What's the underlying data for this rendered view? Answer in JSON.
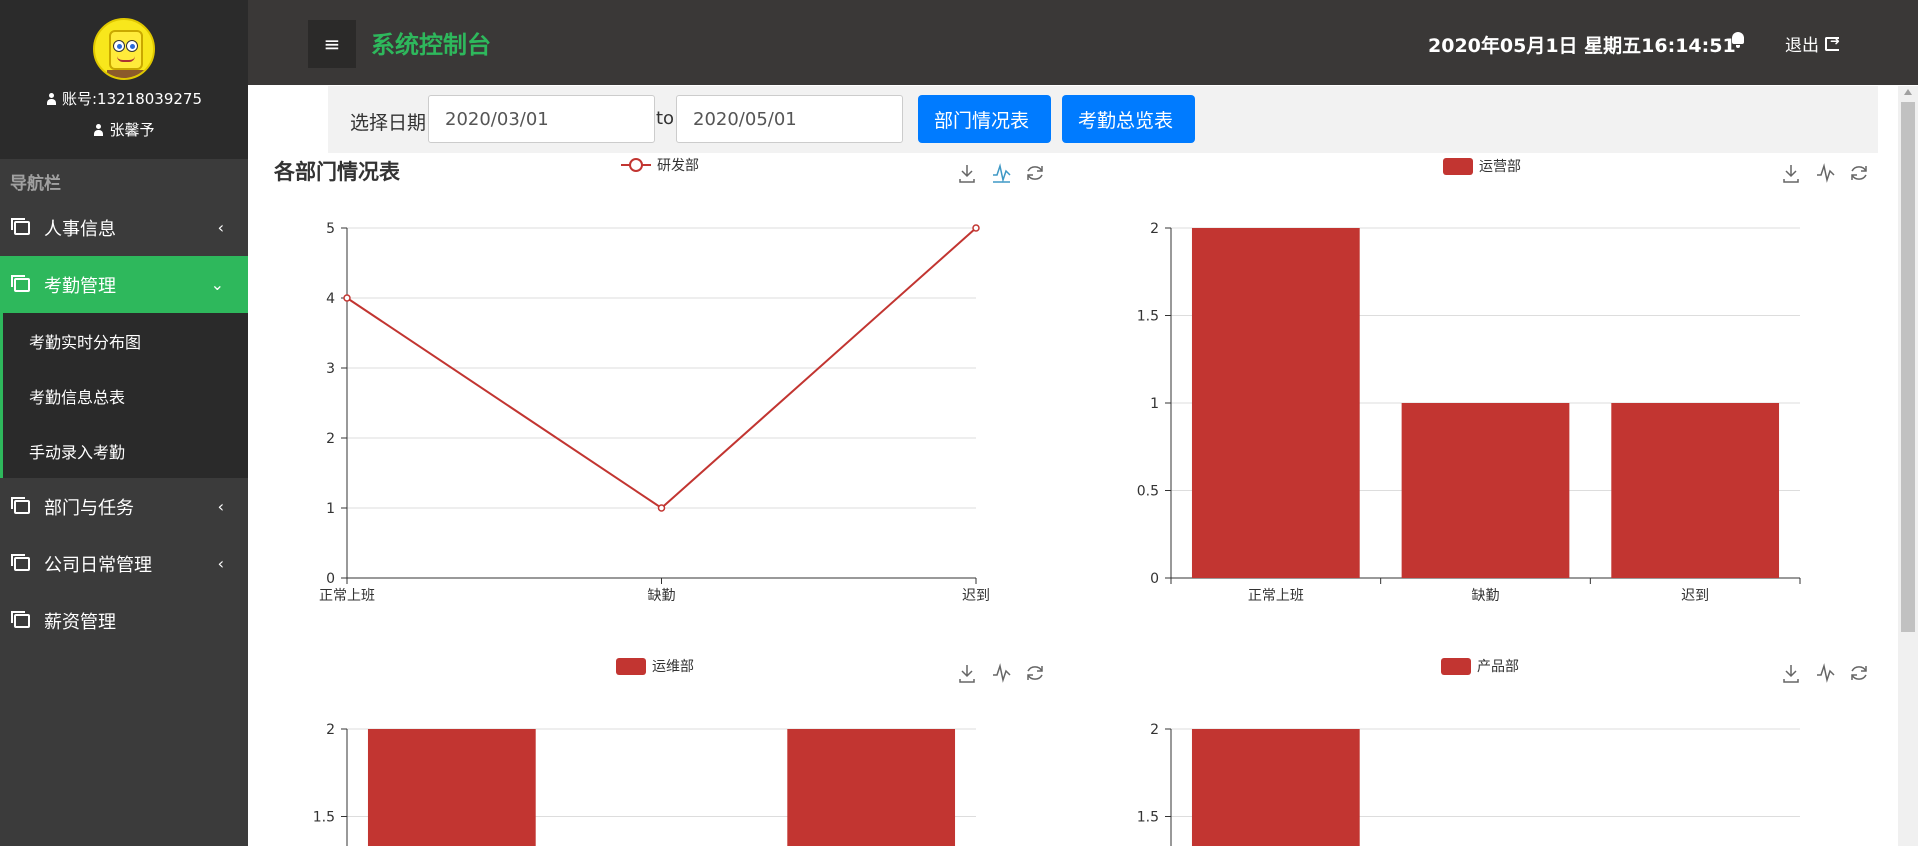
{
  "profile": {
    "account": "账号:13218039275",
    "name": "张馨予"
  },
  "nav": {
    "title": "导航栏",
    "items": [
      {
        "label": "人事信息",
        "chevron": "‹"
      },
      {
        "label": "考勤管理",
        "chevron": "⌄"
      },
      {
        "label": "部门与任务",
        "chevron": "‹"
      },
      {
        "label": "公司日常管理",
        "chevron": "‹"
      },
      {
        "label": "薪资管理",
        "chevron": ""
      }
    ],
    "subitems": [
      {
        "label": "考勤实时分布图"
      },
      {
        "label": "考勤信息总表"
      },
      {
        "label": "手动录入考勤"
      }
    ]
  },
  "header": {
    "brand": "系统控制台",
    "datetime": "2020年05月1日 星期五16:14:51",
    "logout": "退出"
  },
  "datebar": {
    "label": "选择日期",
    "from": "2020/03/01",
    "to_label": "to",
    "to": "2020/05/01",
    "btn_dept": "部门情况表",
    "btn_overview": "考勤总览表"
  },
  "panel": {
    "title": "各部门情况表"
  },
  "colors": {
    "series": "#c23531",
    "accent": "#2eb85c",
    "button": "#007bff"
  },
  "chart_data": [
    {
      "type": "line",
      "legend": "研发部",
      "categories": [
        "正常上班",
        "缺勤",
        "迟到"
      ],
      "series": [
        {
          "name": "研发部",
          "values": [
            4,
            1,
            5
          ]
        }
      ],
      "yticks": [
        "0",
        "1",
        "2",
        "3",
        "4",
        "5"
      ],
      "ylim": [
        0,
        5
      ]
    },
    {
      "type": "bar",
      "legend": "运营部",
      "categories": [
        "正常上班",
        "缺勤",
        "迟到"
      ],
      "series": [
        {
          "name": "运营部",
          "values": [
            2,
            1,
            1
          ]
        }
      ],
      "yticks": [
        "0",
        "0.5",
        "1",
        "1.5",
        "2"
      ],
      "ylim": [
        0,
        2
      ]
    },
    {
      "type": "bar",
      "legend": "运维部",
      "series": [
        {
          "name": "运维部",
          "values": [
            2,
            2
          ]
        }
      ],
      "yticks": [
        "1.5",
        "2"
      ],
      "ylim": [
        0,
        2
      ]
    },
    {
      "type": "bar",
      "legend": "产品部",
      "series": [
        {
          "name": "产品部",
          "values": [
            2
          ]
        }
      ],
      "yticks": [
        "1.5",
        "2"
      ],
      "ylim": [
        0,
        2
      ]
    }
  ]
}
